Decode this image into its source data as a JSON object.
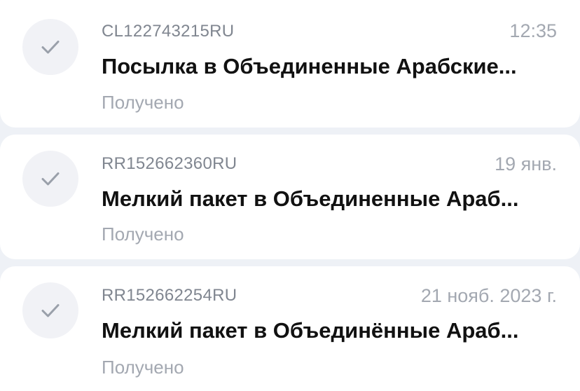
{
  "shipments": [
    {
      "track_number": "CL122743215RU",
      "date": "12:35",
      "title": "Посылка в Объединенные Арабские...",
      "status": "Получено",
      "status_icon": "checkmark-icon"
    },
    {
      "track_number": "RR152662360RU",
      "date": "19 янв.",
      "title": "Мелкий пакет в Объединенные Араб...",
      "status": "Получено",
      "status_icon": "checkmark-icon"
    },
    {
      "track_number": "RR152662254RU",
      "date": "21 нояб. 2023 г.",
      "title": "Мелкий пакет в Объединённые Араб...",
      "status": "Получено",
      "status_icon": "checkmark-icon"
    }
  ],
  "colors": {
    "background": "#eef1f6",
    "card": "#ffffff",
    "icon_circle": "#f1f2f6",
    "checkmark": "#9aa0aa",
    "title": "#111111",
    "secondary_text": "#a3a8b1"
  }
}
